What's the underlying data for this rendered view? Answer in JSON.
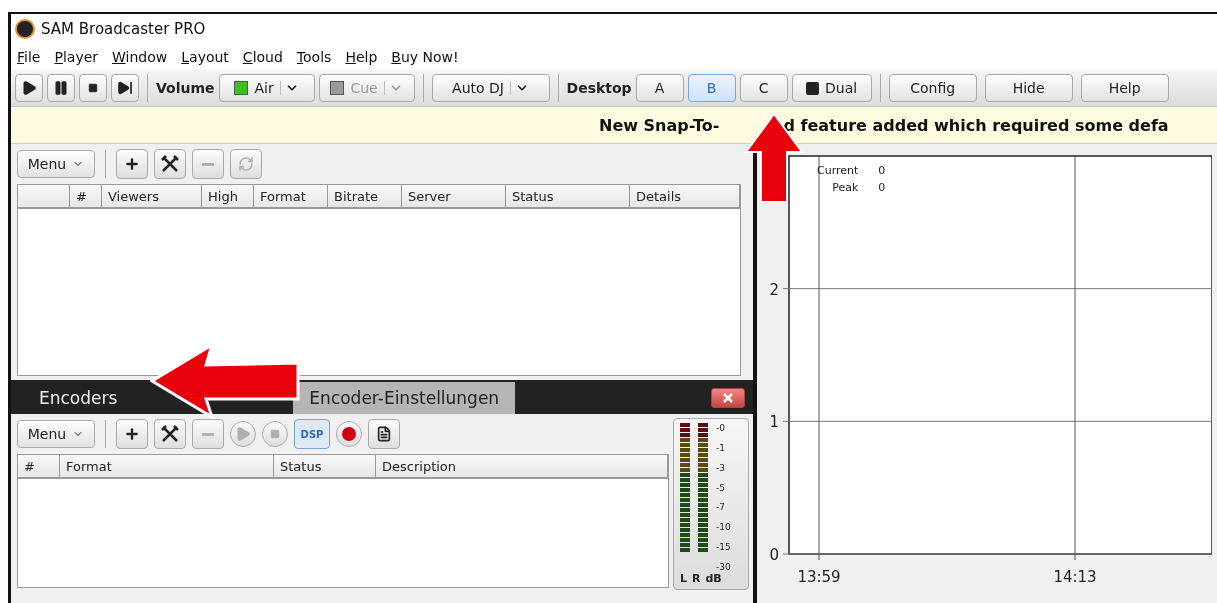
{
  "window": {
    "title": "SAM Broadcaster PRO"
  },
  "menu": [
    "File",
    "Player",
    "Window",
    "Layout",
    "Cloud",
    "Tools",
    "Help",
    "Buy Now!"
  ],
  "toolbar": {
    "transport": [
      {
        "kind": "play",
        "disabled": false
      },
      {
        "kind": "pause",
        "disabled": false
      },
      {
        "kind": "stop",
        "disabled": false
      },
      {
        "kind": "next",
        "disabled": false
      }
    ],
    "volume_label": "Volume",
    "outputs": [
      {
        "label": "Air",
        "on": true,
        "disabled": false
      },
      {
        "label": "Cue",
        "on": false,
        "disabled": true
      }
    ],
    "auto_dj": "Auto DJ",
    "desktop_label": "Desktop",
    "desktops": [
      {
        "label": "A",
        "selected": false
      },
      {
        "label": "B",
        "selected": true
      },
      {
        "label": "C",
        "selected": false
      }
    ],
    "dual": {
      "label": "Dual",
      "on": false
    },
    "buttons": [
      "Config",
      "Hide",
      "Help"
    ]
  },
  "banner": {
    "parts": [
      "New Snap-To-",
      "d feature added which required some defa"
    ]
  },
  "listeners_panel": {
    "menu": "Menu",
    "tools": [
      {
        "kind": "add",
        "disabled": false
      },
      {
        "kind": "tools",
        "disabled": false
      },
      {
        "kind": "remove",
        "disabled": true
      },
      {
        "kind": "refresh",
        "disabled": true
      }
    ],
    "columns": [
      "",
      "#",
      "Viewers",
      "High",
      "Format",
      "Bitrate",
      "Server",
      "Status",
      "Details"
    ]
  },
  "encoders_panel": {
    "tabs": [
      {
        "label": "Encoders",
        "selected": false
      },
      {
        "label": "Encoder-Einstellungen",
        "selected": true
      }
    ],
    "menu": "Menu",
    "tools": [
      {
        "kind": "add",
        "disabled": false
      },
      {
        "kind": "tools",
        "disabled": false
      },
      {
        "kind": "remove",
        "disabled": true
      },
      {
        "kind": "play",
        "disabled": true
      },
      {
        "kind": "stop",
        "disabled": true
      },
      {
        "kind": "dsp",
        "label": "DSP"
      },
      {
        "kind": "record"
      },
      {
        "kind": "log"
      }
    ],
    "columns": [
      "#",
      "Format",
      "Status",
      "Description"
    ],
    "meter": {
      "scale": [
        "-0",
        "-1",
        "-3",
        "-5",
        "-7",
        "-10",
        "-15",
        "-30"
      ],
      "footer": [
        "L",
        "R",
        "dB"
      ]
    }
  },
  "graph": {
    "legend": [
      {
        "label": "Current",
        "value": "0"
      },
      {
        "label": "Peak",
        "value": "0"
      }
    ],
    "chart_data": {
      "type": "line",
      "grid": true,
      "ylim": [
        0,
        3
      ],
      "yticks": [
        0,
        1,
        2
      ],
      "categories": [
        "13:59",
        "14:13"
      ]
    }
  }
}
